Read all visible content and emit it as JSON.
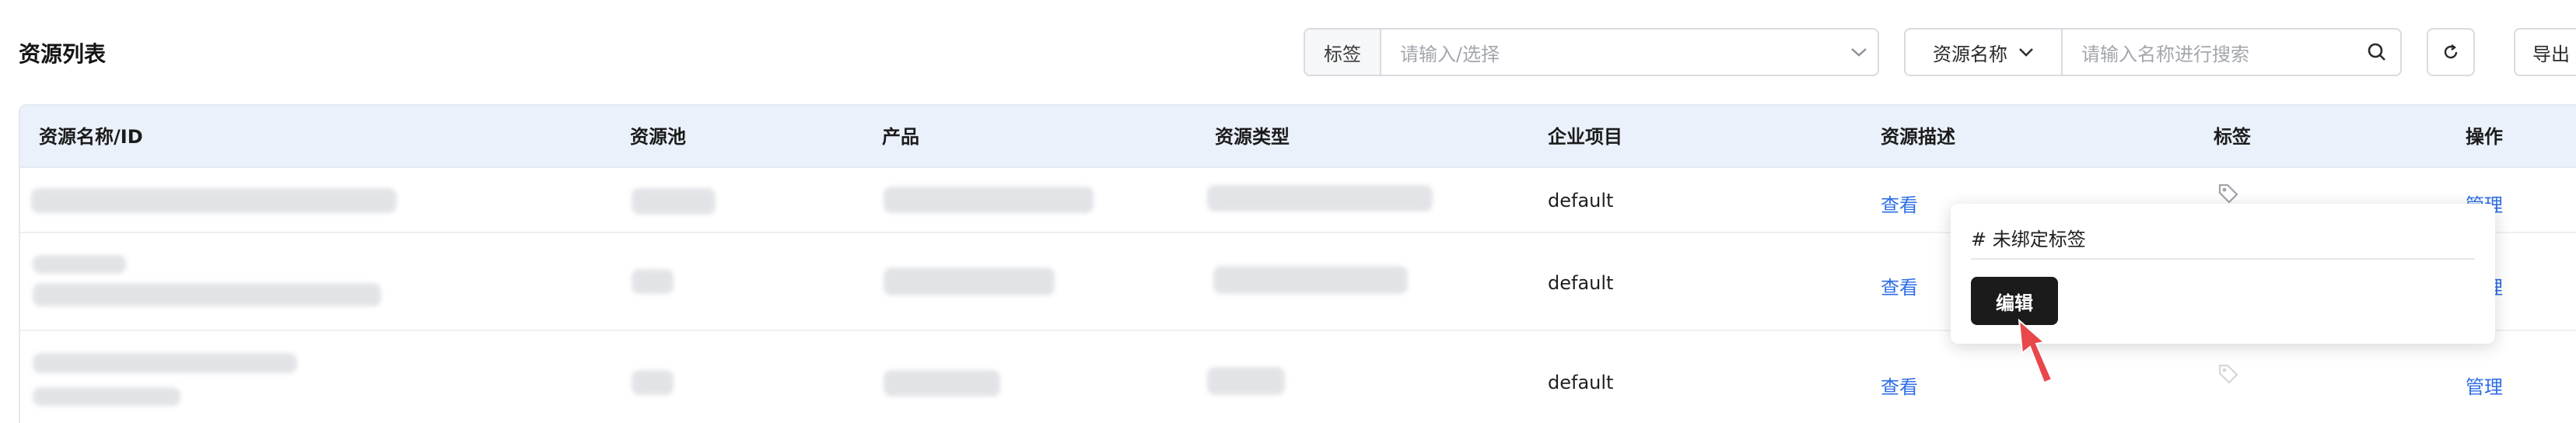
{
  "page": {
    "title": "资源列表"
  },
  "toolbar": {
    "tag_label": "标签",
    "tag_placeholder": "请输入/选择",
    "name_select": "资源名称",
    "name_placeholder": "请输入名称进行搜索",
    "export_label": "导出"
  },
  "table": {
    "headers": [
      "资源名称/ID",
      "资源池",
      "产品",
      "资源类型",
      "企业项目",
      "资源描述",
      "标签",
      "操作"
    ],
    "rows": [
      {
        "project": "default",
        "desc_action": "查看",
        "op": "管理"
      },
      {
        "project": "default",
        "desc_action": "查看",
        "op": "管理"
      },
      {
        "project": "default",
        "desc_action": "查看",
        "op": "管理"
      }
    ]
  },
  "popover": {
    "title": "# 未绑定标签",
    "edit_label": "编辑"
  },
  "icons": {
    "tag": "tag-icon",
    "chevron": "chevron-down-icon",
    "search": "search-icon",
    "refresh": "refresh-icon",
    "pointer": "red-arrow-pointer-icon"
  },
  "colors": {
    "link": "#2e6ee6",
    "header_bg": "#eaf1fb",
    "edit_button": "#1b1b1b",
    "pointer": "#e8474b"
  }
}
